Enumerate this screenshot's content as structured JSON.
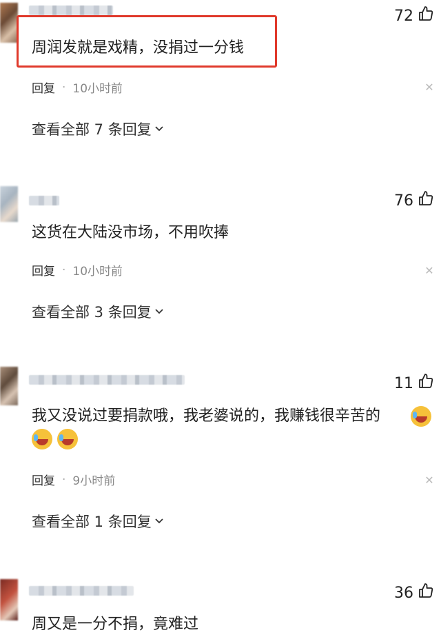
{
  "comments": [
    {
      "likes": "72",
      "text": "周润发就是戏精，没捐过一分钱",
      "reply_label": "回复",
      "dot": "·",
      "time": "10小时前",
      "view_all": "查看全部 7 条回复"
    },
    {
      "likes": "76",
      "text": "这货在大陆没市场，不用吹捧",
      "reply_label": "回复",
      "dot": "·",
      "time": "10小时前",
      "view_all": "查看全部 3 条回复"
    },
    {
      "likes": "11",
      "text": "我又没说过要捐款哦，我老婆说的，我赚钱很辛苦的",
      "reply_label": "回复",
      "dot": "·",
      "time": "9小时前",
      "view_all": "查看全部 1 条回复"
    },
    {
      "likes": "36",
      "text": "周又是一分不捐，竟难过"
    }
  ],
  "icons": {
    "like": "thumbs-up-icon",
    "close": "close-icon",
    "chevron": "chevron-down-icon",
    "emoji": "laughing-crying-emoji"
  },
  "colors": {
    "highlight_border": "#e0392b",
    "meta_text": "#888888"
  }
}
